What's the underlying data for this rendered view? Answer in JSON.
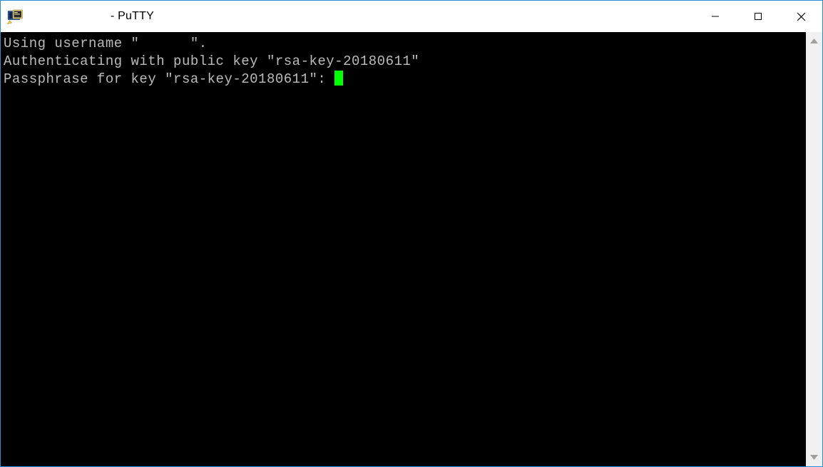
{
  "window": {
    "title_host": "",
    "title_suffix": "- PuTTY",
    "controls": {
      "minimize": "Minimize",
      "maximize": "Maximize",
      "close": "Close"
    }
  },
  "terminal": {
    "lines": [
      "Using username \"      \".",
      "Authenticating with public key \"rsa-key-20180611\"",
      "Passphrase for key \"rsa-key-20180611\": "
    ],
    "cursor_color": "#00ff00",
    "text_color": "#bbbbbb",
    "bg_color": "#000000",
    "key_name": "rsa-key-20180611"
  },
  "scrollbar": {
    "up": "scroll up",
    "down": "scroll down"
  }
}
